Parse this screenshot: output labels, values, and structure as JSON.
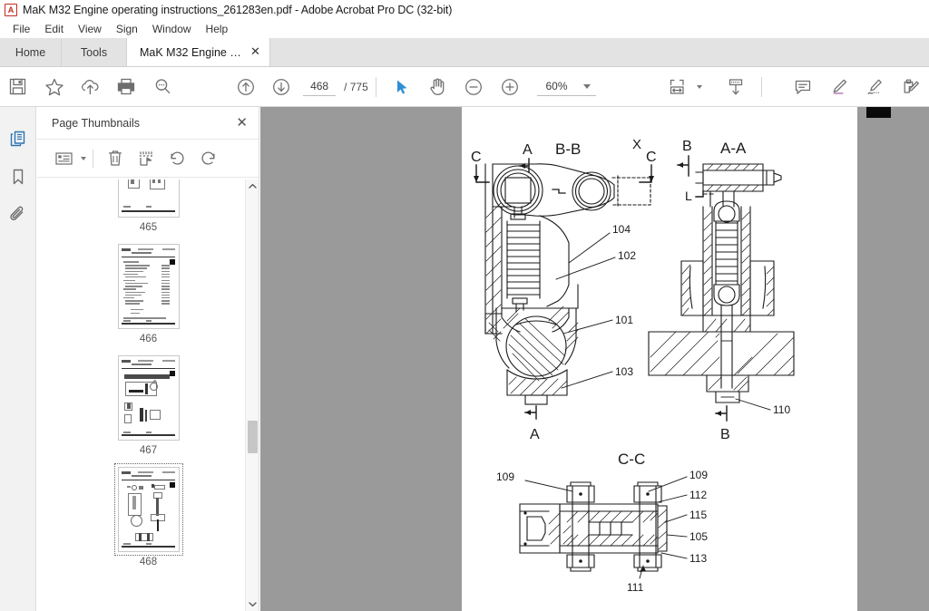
{
  "window": {
    "title": "MaK M32 Engine operating instructions_261283en.pdf - Adobe Acrobat Pro DC (32-bit)",
    "app_icon": "acrobat-icon",
    "icon_glyph": "A"
  },
  "menu": {
    "items": [
      {
        "label": "File",
        "name": "menu-file"
      },
      {
        "label": "Edit",
        "name": "menu-edit"
      },
      {
        "label": "View",
        "name": "menu-view"
      },
      {
        "label": "Sign",
        "name": "menu-sign"
      },
      {
        "label": "Window",
        "name": "menu-window"
      },
      {
        "label": "Help",
        "name": "menu-help"
      }
    ]
  },
  "tabs": {
    "home": "Home",
    "tools": "Tools",
    "document": "MaK M32 Engine o...",
    "close_glyph": "✕"
  },
  "toolbar": {
    "save_title": "Save",
    "star_title": "Add to favorites",
    "cloud_title": "Save to cloud",
    "print_title": "Print",
    "search_title": "Find",
    "prev_title": "Previous page",
    "next_title": "Next page",
    "page_current": "468",
    "page_total": "/ 775",
    "select_title": "Select tool",
    "hand_title": "Hand tool",
    "zoom_out_title": "Zoom out",
    "zoom_in_title": "Zoom in",
    "zoom_level": "60%",
    "fit_title": "Fit page width",
    "scroll_title": "Scroll mode",
    "comment_title": "Add comment",
    "highlight_title": "Highlight text",
    "sign_title": "Fill & Sign",
    "edit_title": "Edit PDF"
  },
  "rail": {
    "items": [
      {
        "name": "page-thumbnails-icon",
        "label": "Page Thumbnails",
        "active": true
      },
      {
        "name": "bookmark-icon",
        "label": "Bookmarks",
        "active": false
      },
      {
        "name": "attachment-icon",
        "label": "Attachments",
        "active": false
      }
    ]
  },
  "thumbnail_panel": {
    "title": "Page Thumbnails",
    "close_glyph": "✕",
    "tools": [
      {
        "name": "thumbnail-size-options-button",
        "label": "Options"
      },
      {
        "name": "delete-pages-button",
        "label": "Delete Pages"
      },
      {
        "name": "extract-pages-button",
        "label": "Extract Pages"
      },
      {
        "name": "rotate-counterclockwise-button",
        "label": "Rotate Counterclockwise"
      },
      {
        "name": "rotate-clockwise-button",
        "label": "Rotate Clockwise"
      }
    ],
    "thumbnails": [
      {
        "page": "465",
        "selected": false,
        "kind": "figure-top"
      },
      {
        "page": "466",
        "selected": false,
        "kind": "table-of-contents"
      },
      {
        "page": "467",
        "selected": false,
        "kind": "figure-assembly"
      },
      {
        "page": "468",
        "selected": true,
        "kind": "figure-sections"
      }
    ],
    "scrollbar": {
      "up_glyph": "∧",
      "down_glyph": "∨"
    }
  },
  "panel_divider": {
    "collapse_label": "Collapse panel"
  },
  "document": {
    "page_number_shown": "468",
    "figure": {
      "view_marker": "X",
      "sections": [
        {
          "name": "section-b-b",
          "title": "B-B",
          "callouts": [
            "104",
            "102",
            "101",
            "103"
          ],
          "cut_marks": [
            "A",
            "C",
            "C",
            "A"
          ]
        },
        {
          "name": "section-a-a",
          "title": "A-A",
          "callouts": [
            "110"
          ],
          "cut_marks": [
            "B",
            "B"
          ]
        },
        {
          "name": "section-c-c",
          "title": "C-C",
          "callouts": [
            "109",
            "109",
            "112",
            "115",
            "105",
            "113",
            "111"
          ],
          "cut_marks": []
        }
      ]
    }
  },
  "colors": {
    "accent": "#2d8fd5",
    "titlebar_bg": "#ffffff",
    "tabstrip_bg": "#e3e3e3",
    "rail_bg": "#f2f2f2",
    "viewport_bg": "#9a9a9a",
    "page_bg": "#ffffff",
    "icon_gray": "#6e6e6e"
  }
}
